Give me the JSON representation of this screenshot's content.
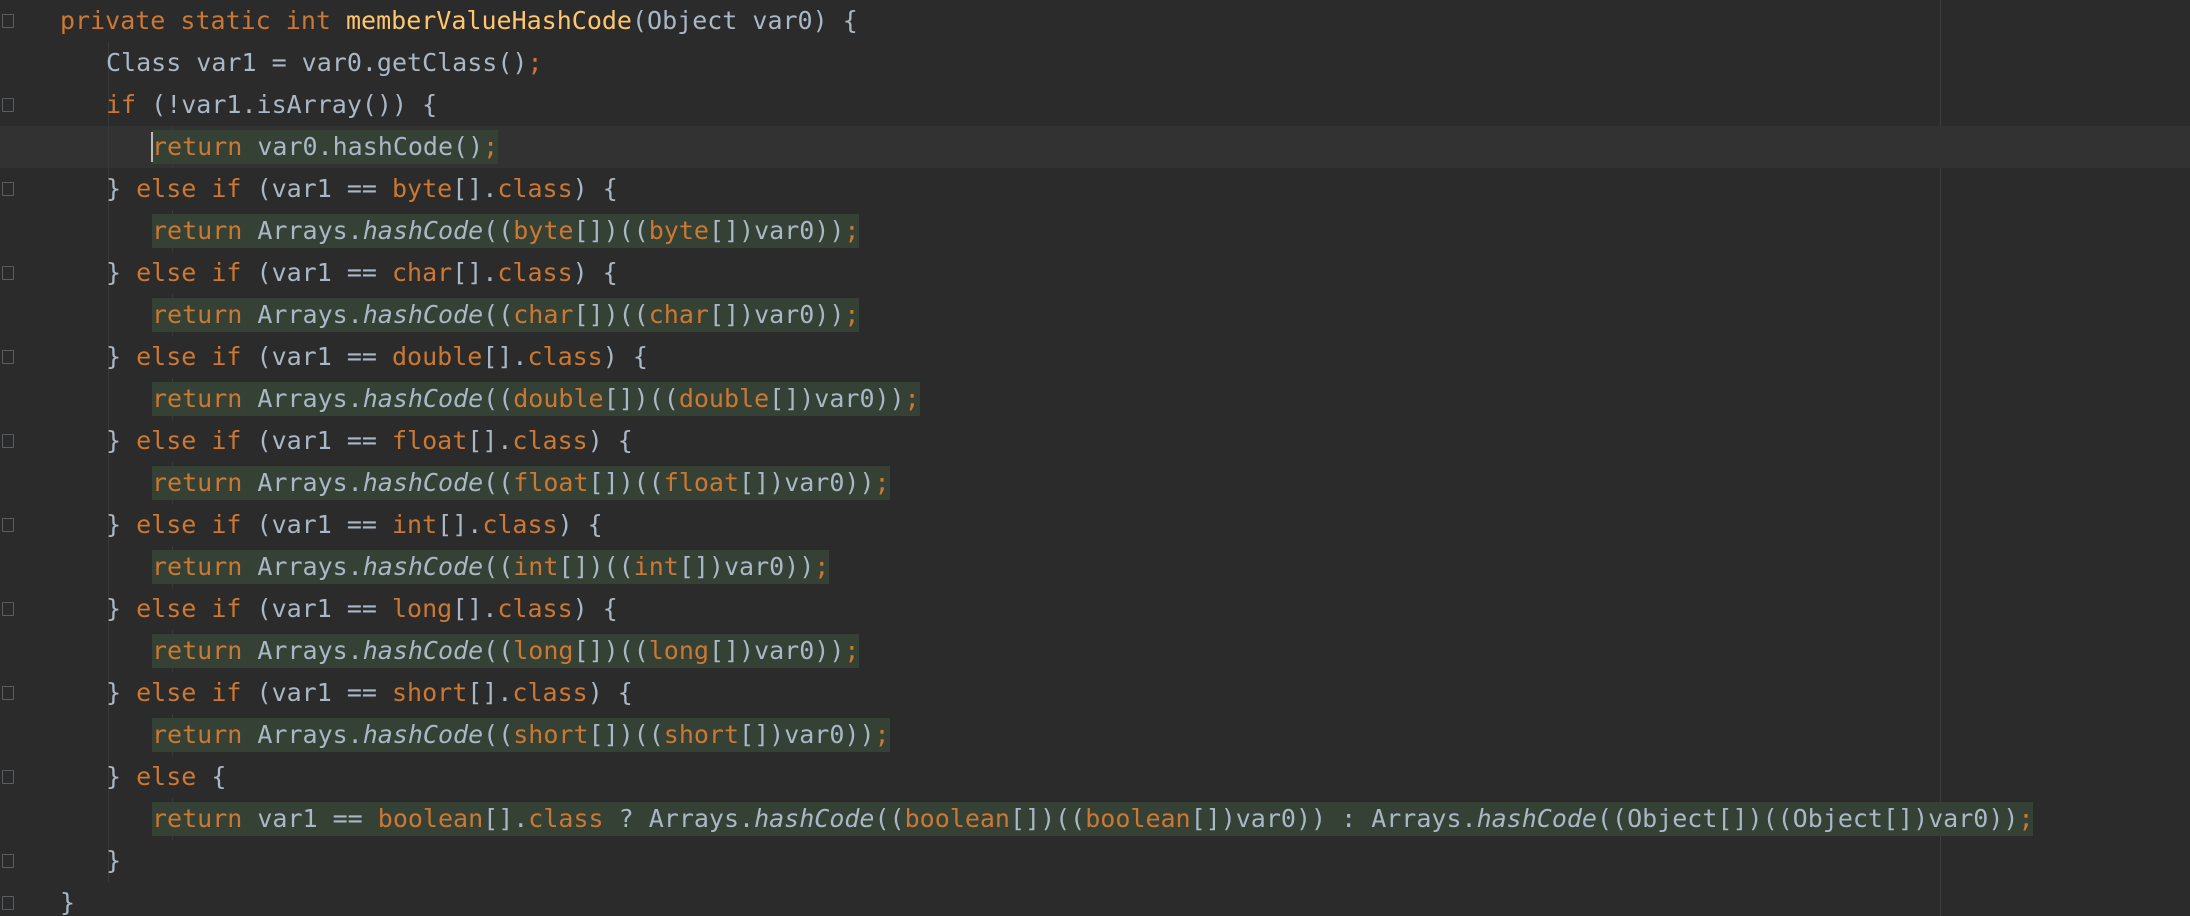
{
  "editor": {
    "theme": {
      "background": "#2b2b2b",
      "caret_line": "#323232",
      "highlight": "#344134",
      "keyword": "#cc7832",
      "method_decl": "#ffc66d",
      "identifier": "#a9b7c6"
    },
    "caret_line": 3,
    "lines": [
      {
        "indent": 1,
        "fold": true,
        "tokens": [
          {
            "t": "private ",
            "c": "kw"
          },
          {
            "t": "static ",
            "c": "kw"
          },
          {
            "t": "int ",
            "c": "kw"
          },
          {
            "t": "memberValueHashCode",
            "c": "fn"
          },
          {
            "t": "(Object var0) {",
            "c": "id"
          }
        ]
      },
      {
        "indent": 2,
        "fold": false,
        "tokens": [
          {
            "t": "Class var1 = var0.getClass()",
            "c": "id"
          },
          {
            "t": ";",
            "c": "kw"
          }
        ]
      },
      {
        "indent": 2,
        "fold": true,
        "tokens": [
          {
            "t": "if ",
            "c": "kw"
          },
          {
            "t": "(!var1.isArray()) {",
            "c": "id"
          }
        ]
      },
      {
        "indent": 3,
        "fold": false,
        "highlight": true,
        "tokens": [
          {
            "t": "return ",
            "c": "kw"
          },
          {
            "t": "var0.hashCode()",
            "c": "id"
          },
          {
            "t": ";",
            "c": "kw"
          }
        ]
      },
      {
        "indent": 2,
        "fold": true,
        "tokens": [
          {
            "t": "} ",
            "c": "id"
          },
          {
            "t": "else if ",
            "c": "kw"
          },
          {
            "t": "(var1 == ",
            "c": "id"
          },
          {
            "t": "byte",
            "c": "kw"
          },
          {
            "t": "[].",
            "c": "id"
          },
          {
            "t": "class",
            "c": "kw"
          },
          {
            "t": ") {",
            "c": "id"
          }
        ]
      },
      {
        "indent": 3,
        "fold": false,
        "highlight": true,
        "tokens": [
          {
            "t": "return ",
            "c": "kw"
          },
          {
            "t": "Arrays.",
            "c": "id"
          },
          {
            "t": "hashCode",
            "c": "call"
          },
          {
            "t": "((",
            "c": "id"
          },
          {
            "t": "byte",
            "c": "kw"
          },
          {
            "t": "[])((",
            "c": "id"
          },
          {
            "t": "byte",
            "c": "kw"
          },
          {
            "t": "[])var0))",
            "c": "id"
          },
          {
            "t": ";",
            "c": "kw"
          }
        ]
      },
      {
        "indent": 2,
        "fold": true,
        "tokens": [
          {
            "t": "} ",
            "c": "id"
          },
          {
            "t": "else if ",
            "c": "kw"
          },
          {
            "t": "(var1 == ",
            "c": "id"
          },
          {
            "t": "char",
            "c": "kw"
          },
          {
            "t": "[].",
            "c": "id"
          },
          {
            "t": "class",
            "c": "kw"
          },
          {
            "t": ") {",
            "c": "id"
          }
        ]
      },
      {
        "indent": 3,
        "fold": false,
        "highlight": true,
        "tokens": [
          {
            "t": "return ",
            "c": "kw"
          },
          {
            "t": "Arrays.",
            "c": "id"
          },
          {
            "t": "hashCode",
            "c": "call"
          },
          {
            "t": "((",
            "c": "id"
          },
          {
            "t": "char",
            "c": "kw"
          },
          {
            "t": "[])((",
            "c": "id"
          },
          {
            "t": "char",
            "c": "kw"
          },
          {
            "t": "[])var0))",
            "c": "id"
          },
          {
            "t": ";",
            "c": "kw"
          }
        ]
      },
      {
        "indent": 2,
        "fold": true,
        "tokens": [
          {
            "t": "} ",
            "c": "id"
          },
          {
            "t": "else if ",
            "c": "kw"
          },
          {
            "t": "(var1 == ",
            "c": "id"
          },
          {
            "t": "double",
            "c": "kw"
          },
          {
            "t": "[].",
            "c": "id"
          },
          {
            "t": "class",
            "c": "kw"
          },
          {
            "t": ") {",
            "c": "id"
          }
        ]
      },
      {
        "indent": 3,
        "fold": false,
        "highlight": true,
        "tokens": [
          {
            "t": "return ",
            "c": "kw"
          },
          {
            "t": "Arrays.",
            "c": "id"
          },
          {
            "t": "hashCode",
            "c": "call"
          },
          {
            "t": "((",
            "c": "id"
          },
          {
            "t": "double",
            "c": "kw"
          },
          {
            "t": "[])((",
            "c": "id"
          },
          {
            "t": "double",
            "c": "kw"
          },
          {
            "t": "[])var0))",
            "c": "id"
          },
          {
            "t": ";",
            "c": "kw"
          }
        ]
      },
      {
        "indent": 2,
        "fold": true,
        "tokens": [
          {
            "t": "} ",
            "c": "id"
          },
          {
            "t": "else if ",
            "c": "kw"
          },
          {
            "t": "(var1 == ",
            "c": "id"
          },
          {
            "t": "float",
            "c": "kw"
          },
          {
            "t": "[].",
            "c": "id"
          },
          {
            "t": "class",
            "c": "kw"
          },
          {
            "t": ") {",
            "c": "id"
          }
        ]
      },
      {
        "indent": 3,
        "fold": false,
        "highlight": true,
        "tokens": [
          {
            "t": "return ",
            "c": "kw"
          },
          {
            "t": "Arrays.",
            "c": "id"
          },
          {
            "t": "hashCode",
            "c": "call"
          },
          {
            "t": "((",
            "c": "id"
          },
          {
            "t": "float",
            "c": "kw"
          },
          {
            "t": "[])((",
            "c": "id"
          },
          {
            "t": "float",
            "c": "kw"
          },
          {
            "t": "[])var0))",
            "c": "id"
          },
          {
            "t": ";",
            "c": "kw"
          }
        ]
      },
      {
        "indent": 2,
        "fold": true,
        "tokens": [
          {
            "t": "} ",
            "c": "id"
          },
          {
            "t": "else if ",
            "c": "kw"
          },
          {
            "t": "(var1 == ",
            "c": "id"
          },
          {
            "t": "int",
            "c": "kw"
          },
          {
            "t": "[].",
            "c": "id"
          },
          {
            "t": "class",
            "c": "kw"
          },
          {
            "t": ") {",
            "c": "id"
          }
        ]
      },
      {
        "indent": 3,
        "fold": false,
        "highlight": true,
        "tokens": [
          {
            "t": "return ",
            "c": "kw"
          },
          {
            "t": "Arrays.",
            "c": "id"
          },
          {
            "t": "hashCode",
            "c": "call"
          },
          {
            "t": "((",
            "c": "id"
          },
          {
            "t": "int",
            "c": "kw"
          },
          {
            "t": "[])((",
            "c": "id"
          },
          {
            "t": "int",
            "c": "kw"
          },
          {
            "t": "[])var0))",
            "c": "id"
          },
          {
            "t": ";",
            "c": "kw"
          }
        ]
      },
      {
        "indent": 2,
        "fold": true,
        "tokens": [
          {
            "t": "} ",
            "c": "id"
          },
          {
            "t": "else if ",
            "c": "kw"
          },
          {
            "t": "(var1 == ",
            "c": "id"
          },
          {
            "t": "long",
            "c": "kw"
          },
          {
            "t": "[].",
            "c": "id"
          },
          {
            "t": "class",
            "c": "kw"
          },
          {
            "t": ") {",
            "c": "id"
          }
        ]
      },
      {
        "indent": 3,
        "fold": false,
        "highlight": true,
        "tokens": [
          {
            "t": "return ",
            "c": "kw"
          },
          {
            "t": "Arrays.",
            "c": "id"
          },
          {
            "t": "hashCode",
            "c": "call"
          },
          {
            "t": "((",
            "c": "id"
          },
          {
            "t": "long",
            "c": "kw"
          },
          {
            "t": "[])((",
            "c": "id"
          },
          {
            "t": "long",
            "c": "kw"
          },
          {
            "t": "[])var0))",
            "c": "id"
          },
          {
            "t": ";",
            "c": "kw"
          }
        ]
      },
      {
        "indent": 2,
        "fold": true,
        "tokens": [
          {
            "t": "} ",
            "c": "id"
          },
          {
            "t": "else if ",
            "c": "kw"
          },
          {
            "t": "(var1 == ",
            "c": "id"
          },
          {
            "t": "short",
            "c": "kw"
          },
          {
            "t": "[].",
            "c": "id"
          },
          {
            "t": "class",
            "c": "kw"
          },
          {
            "t": ") {",
            "c": "id"
          }
        ]
      },
      {
        "indent": 3,
        "fold": false,
        "highlight": true,
        "tokens": [
          {
            "t": "return ",
            "c": "kw"
          },
          {
            "t": "Arrays.",
            "c": "id"
          },
          {
            "t": "hashCode",
            "c": "call"
          },
          {
            "t": "((",
            "c": "id"
          },
          {
            "t": "short",
            "c": "kw"
          },
          {
            "t": "[])((",
            "c": "id"
          },
          {
            "t": "short",
            "c": "kw"
          },
          {
            "t": "[])var0))",
            "c": "id"
          },
          {
            "t": ";",
            "c": "kw"
          }
        ]
      },
      {
        "indent": 2,
        "fold": true,
        "tokens": [
          {
            "t": "} ",
            "c": "id"
          },
          {
            "t": "else ",
            "c": "kw"
          },
          {
            "t": "{",
            "c": "id"
          }
        ]
      },
      {
        "indent": 3,
        "fold": false,
        "highlight": true,
        "tokens": [
          {
            "t": "return ",
            "c": "kw"
          },
          {
            "t": "var1 == ",
            "c": "id"
          },
          {
            "t": "boolean",
            "c": "kw"
          },
          {
            "t": "[].",
            "c": "id"
          },
          {
            "t": "class ",
            "c": "kw"
          },
          {
            "t": "? Arrays.",
            "c": "id"
          },
          {
            "t": "hashCode",
            "c": "call"
          },
          {
            "t": "((",
            "c": "id"
          },
          {
            "t": "boolean",
            "c": "kw"
          },
          {
            "t": "[])((",
            "c": "id"
          },
          {
            "t": "boolean",
            "c": "kw"
          },
          {
            "t": "[])var0)) : Arrays.",
            "c": "id"
          },
          {
            "t": "hashCode",
            "c": "call"
          },
          {
            "t": "((Object[])((Object[])var0))",
            "c": "id"
          },
          {
            "t": ";",
            "c": "kw"
          }
        ]
      },
      {
        "indent": 2,
        "fold": true,
        "tokens": [
          {
            "t": "}",
            "c": "id"
          }
        ]
      },
      {
        "indent": 1,
        "fold": true,
        "tokens": [
          {
            "t": "}",
            "c": "id"
          }
        ]
      }
    ]
  }
}
